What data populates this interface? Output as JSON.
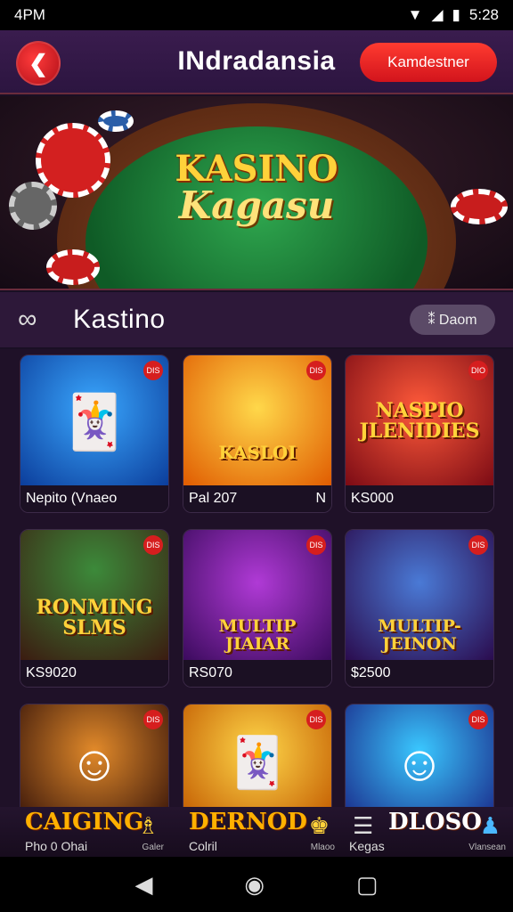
{
  "status_bar": {
    "time": "4PM",
    "battery_time": "5:28"
  },
  "header": {
    "title": "INdradansia",
    "action_label": "Kamdestner"
  },
  "hero": {
    "title_line1": "KASINO",
    "title_line2": "Kagasu"
  },
  "section": {
    "title": "Kastino",
    "filter_label": "⁑ Daom"
  },
  "games": [
    {
      "art_text": "",
      "caption_left": "Nepito (Vnaeo",
      "caption_right": "",
      "badge": "DIS"
    },
    {
      "art_text": "KASLOI",
      "caption_left": "Pal 207",
      "caption_right": "N",
      "badge": "DIS"
    },
    {
      "art_text": "NASPIO\nJLENIDIES",
      "caption_left": "KS000",
      "caption_right": "",
      "badge": "DIO"
    },
    {
      "art_text": "RONMING\nSLMS",
      "caption_left": "KS9020",
      "caption_right": "",
      "badge": "DIS"
    },
    {
      "art_text": "MULTIP JIAIAR",
      "caption_left": "RS070",
      "caption_right": "",
      "badge": "DIS"
    },
    {
      "art_text": "MULTIP-JEINON",
      "caption_left": "$2500",
      "caption_right": "",
      "badge": "DIS"
    },
    {
      "art_text": "",
      "caption_left": "",
      "caption_right": "",
      "badge": "DIS"
    },
    {
      "art_text": "",
      "caption_left": "",
      "caption_right": "",
      "badge": "DIS"
    },
    {
      "art_text": "",
      "caption_left": "",
      "caption_right": "",
      "badge": "DIS"
    }
  ],
  "bottom_nav": [
    {
      "big": "CAIGING",
      "small": "Pho 0 Ohai",
      "icon_label": "Galer"
    },
    {
      "big": "DERNOD",
      "small": "Colril",
      "icon_label": "Mlaoo"
    },
    {
      "big": "DLOSO",
      "small": "Kegas",
      "icon_label": "Vlansean"
    }
  ],
  "colors": {
    "accent": "#e0221e",
    "gold": "#ffd23a",
    "background": "#1a0f24"
  }
}
